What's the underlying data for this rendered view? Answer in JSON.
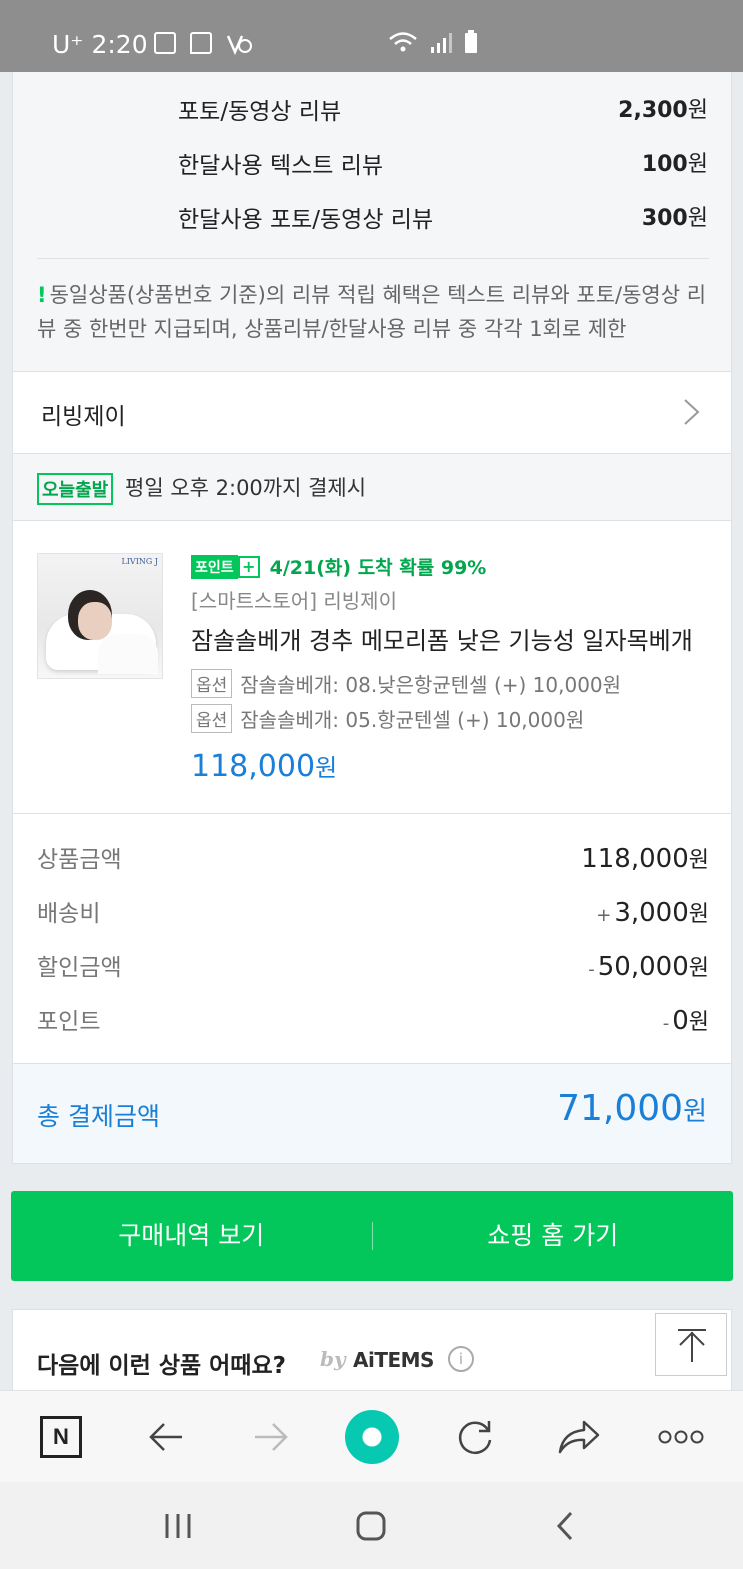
{
  "status_bar": {
    "carrier": "U⁺",
    "time": "2:20"
  },
  "reward": {
    "rows": [
      {
        "label": "포토/동영상 리뷰",
        "amount": "2,300",
        "unit": "원"
      },
      {
        "label": "한달사용 텍스트 리뷰",
        "amount": "100",
        "unit": "원"
      },
      {
        "label": "한달사용 포토/동영상 리뷰",
        "amount": "300",
        "unit": "원"
      }
    ],
    "notice_mark": "!",
    "notice": "동일상품(상품번호 기준)의 리뷰 적립 혜택은 텍스트 리뷰와 포토/동영상 리뷰 중 한번만 지급되며, 상품리뷰/한달사용 리뷰 중 각각 1회로 제한"
  },
  "seller": {
    "name": "리빙제이"
  },
  "dispatch": {
    "badge": "오늘출발",
    "text": "평일 오후 2:00까지 결제시"
  },
  "product": {
    "thumb_brand": "LIVING J",
    "point_badge": "포인트",
    "point_plus": "+",
    "eta": "4/21(화) 도착 확률 99%",
    "store": "[스마트스토어] 리빙제이",
    "title": "잠솔솔베개 경추 메모리폼 낮은 기능성 일자목베개",
    "options": [
      {
        "tag": "옵션",
        "text": "잠솔솔베개: 08.낮은항균텐셀 (+) 10,000원"
      },
      {
        "tag": "옵션",
        "text": "잠솔솔베개: 05.항균텐셀 (+) 10,000원"
      }
    ],
    "price": "118,000",
    "price_unit": "원"
  },
  "summary": {
    "rows": [
      {
        "label": "상품금액",
        "sign": "",
        "value": "118,000",
        "unit": "원"
      },
      {
        "label": "배송비",
        "sign": "+",
        "value": "3,000",
        "unit": "원"
      },
      {
        "label": "할인금액",
        "sign": "-",
        "value": "50,000",
        "unit": "원"
      },
      {
        "label": "포인트",
        "sign": "-",
        "value": "0",
        "unit": "원"
      }
    ],
    "total_label": "총 결제금액",
    "total_value": "71,000",
    "total_unit": "원"
  },
  "actions": {
    "history": "구매내역 보기",
    "home": "쇼핑 홈 가기"
  },
  "recommend": {
    "title": "다음에 이런 상품 어때요?",
    "by": "by",
    "brand": "AiTEMS",
    "info": "i"
  },
  "browser": {
    "n_label": "N"
  },
  "colors": {
    "naver_green": "#03c75a",
    "price_blue": "#1a7fd6"
  }
}
